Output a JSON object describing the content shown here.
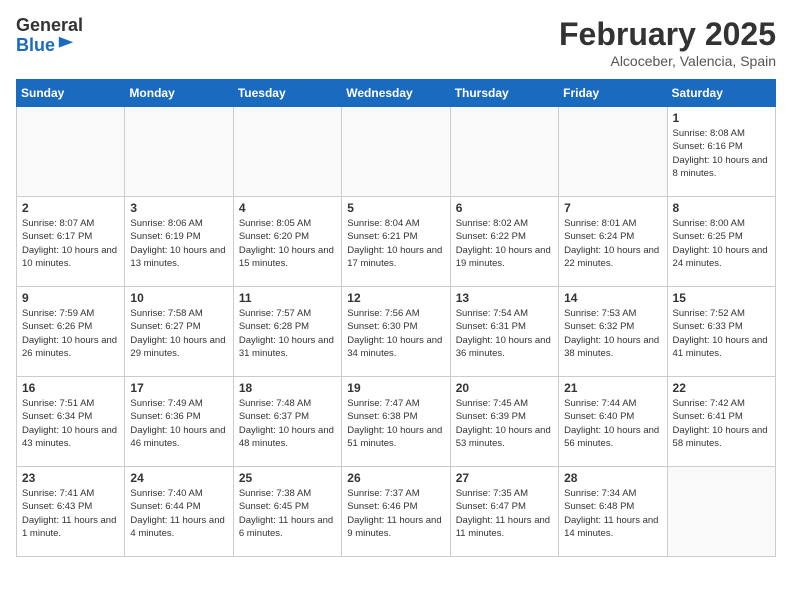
{
  "header": {
    "logo_general": "General",
    "logo_blue": "Blue",
    "title": "February 2025",
    "subtitle": "Alcoceber, Valencia, Spain"
  },
  "calendar": {
    "days_of_week": [
      "Sunday",
      "Monday",
      "Tuesday",
      "Wednesday",
      "Thursday",
      "Friday",
      "Saturday"
    ],
    "weeks": [
      [
        {
          "day": "",
          "info": ""
        },
        {
          "day": "",
          "info": ""
        },
        {
          "day": "",
          "info": ""
        },
        {
          "day": "",
          "info": ""
        },
        {
          "day": "",
          "info": ""
        },
        {
          "day": "",
          "info": ""
        },
        {
          "day": "1",
          "info": "Sunrise: 8:08 AM\nSunset: 6:16 PM\nDaylight: 10 hours and 8 minutes."
        }
      ],
      [
        {
          "day": "2",
          "info": "Sunrise: 8:07 AM\nSunset: 6:17 PM\nDaylight: 10 hours and 10 minutes."
        },
        {
          "day": "3",
          "info": "Sunrise: 8:06 AM\nSunset: 6:19 PM\nDaylight: 10 hours and 13 minutes."
        },
        {
          "day": "4",
          "info": "Sunrise: 8:05 AM\nSunset: 6:20 PM\nDaylight: 10 hours and 15 minutes."
        },
        {
          "day": "5",
          "info": "Sunrise: 8:04 AM\nSunset: 6:21 PM\nDaylight: 10 hours and 17 minutes."
        },
        {
          "day": "6",
          "info": "Sunrise: 8:02 AM\nSunset: 6:22 PM\nDaylight: 10 hours and 19 minutes."
        },
        {
          "day": "7",
          "info": "Sunrise: 8:01 AM\nSunset: 6:24 PM\nDaylight: 10 hours and 22 minutes."
        },
        {
          "day": "8",
          "info": "Sunrise: 8:00 AM\nSunset: 6:25 PM\nDaylight: 10 hours and 24 minutes."
        }
      ],
      [
        {
          "day": "9",
          "info": "Sunrise: 7:59 AM\nSunset: 6:26 PM\nDaylight: 10 hours and 26 minutes."
        },
        {
          "day": "10",
          "info": "Sunrise: 7:58 AM\nSunset: 6:27 PM\nDaylight: 10 hours and 29 minutes."
        },
        {
          "day": "11",
          "info": "Sunrise: 7:57 AM\nSunset: 6:28 PM\nDaylight: 10 hours and 31 minutes."
        },
        {
          "day": "12",
          "info": "Sunrise: 7:56 AM\nSunset: 6:30 PM\nDaylight: 10 hours and 34 minutes."
        },
        {
          "day": "13",
          "info": "Sunrise: 7:54 AM\nSunset: 6:31 PM\nDaylight: 10 hours and 36 minutes."
        },
        {
          "day": "14",
          "info": "Sunrise: 7:53 AM\nSunset: 6:32 PM\nDaylight: 10 hours and 38 minutes."
        },
        {
          "day": "15",
          "info": "Sunrise: 7:52 AM\nSunset: 6:33 PM\nDaylight: 10 hours and 41 minutes."
        }
      ],
      [
        {
          "day": "16",
          "info": "Sunrise: 7:51 AM\nSunset: 6:34 PM\nDaylight: 10 hours and 43 minutes."
        },
        {
          "day": "17",
          "info": "Sunrise: 7:49 AM\nSunset: 6:36 PM\nDaylight: 10 hours and 46 minutes."
        },
        {
          "day": "18",
          "info": "Sunrise: 7:48 AM\nSunset: 6:37 PM\nDaylight: 10 hours and 48 minutes."
        },
        {
          "day": "19",
          "info": "Sunrise: 7:47 AM\nSunset: 6:38 PM\nDaylight: 10 hours and 51 minutes."
        },
        {
          "day": "20",
          "info": "Sunrise: 7:45 AM\nSunset: 6:39 PM\nDaylight: 10 hours and 53 minutes."
        },
        {
          "day": "21",
          "info": "Sunrise: 7:44 AM\nSunset: 6:40 PM\nDaylight: 10 hours and 56 minutes."
        },
        {
          "day": "22",
          "info": "Sunrise: 7:42 AM\nSunset: 6:41 PM\nDaylight: 10 hours and 58 minutes."
        }
      ],
      [
        {
          "day": "23",
          "info": "Sunrise: 7:41 AM\nSunset: 6:43 PM\nDaylight: 11 hours and 1 minute."
        },
        {
          "day": "24",
          "info": "Sunrise: 7:40 AM\nSunset: 6:44 PM\nDaylight: 11 hours and 4 minutes."
        },
        {
          "day": "25",
          "info": "Sunrise: 7:38 AM\nSunset: 6:45 PM\nDaylight: 11 hours and 6 minutes."
        },
        {
          "day": "26",
          "info": "Sunrise: 7:37 AM\nSunset: 6:46 PM\nDaylight: 11 hours and 9 minutes."
        },
        {
          "day": "27",
          "info": "Sunrise: 7:35 AM\nSunset: 6:47 PM\nDaylight: 11 hours and 11 minutes."
        },
        {
          "day": "28",
          "info": "Sunrise: 7:34 AM\nSunset: 6:48 PM\nDaylight: 11 hours and 14 minutes."
        },
        {
          "day": "",
          "info": ""
        }
      ]
    ]
  }
}
